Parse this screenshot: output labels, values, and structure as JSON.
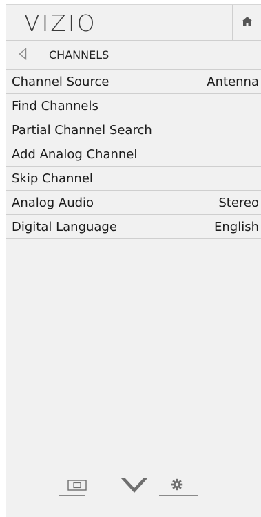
{
  "header": {
    "logo": "VIZIO",
    "home_icon": "home-icon"
  },
  "breadcrumb": {
    "back_icon": "back-triangle-icon",
    "title": "CHANNELS"
  },
  "menu": {
    "items": [
      {
        "label": "Channel Source",
        "value": "Antenna"
      },
      {
        "label": "Find Channels",
        "value": ""
      },
      {
        "label": "Partial Channel Search",
        "value": ""
      },
      {
        "label": "Add Analog Channel",
        "value": ""
      },
      {
        "label": "Skip Channel",
        "value": ""
      },
      {
        "label": "Analog Audio",
        "value": "Stereo"
      },
      {
        "label": "Digital Language",
        "value": "English"
      }
    ]
  },
  "bottom_nav": {
    "icons": [
      "wide-screen-icon",
      "vizio-v-icon",
      "gear-icon"
    ]
  },
  "colors": {
    "panel": "#f1f1f1",
    "divider": "#cfcfcf",
    "text": "#1c1c1c",
    "icon": "#777777"
  }
}
